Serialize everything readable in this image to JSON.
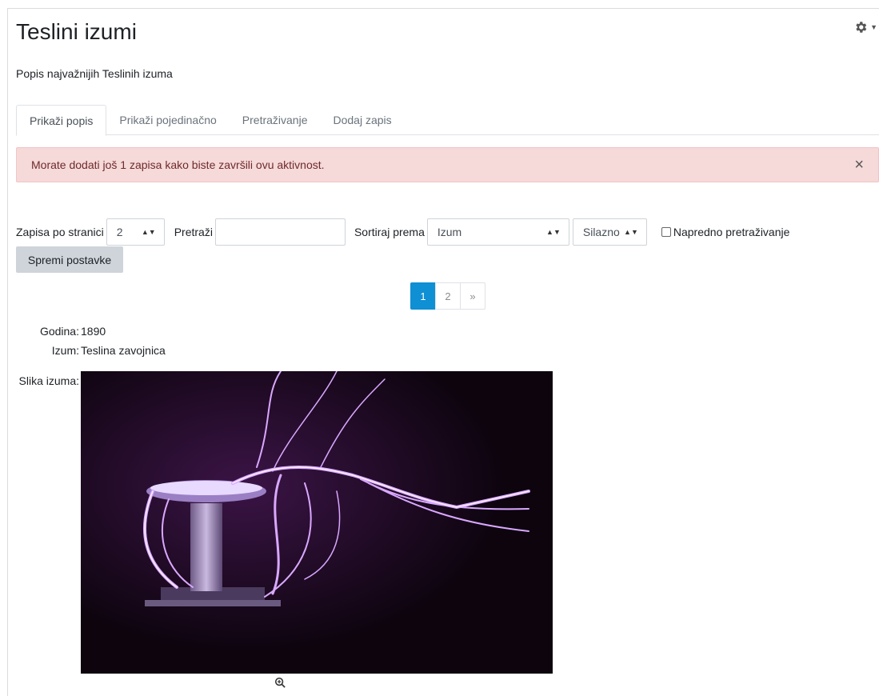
{
  "page": {
    "title": "Teslini izumi",
    "description": "Popis najvažnijih Teslinih izuma"
  },
  "tabs": [
    {
      "label": "Prikaži popis",
      "active": true
    },
    {
      "label": "Prikaži pojedinačno",
      "active": false
    },
    {
      "label": "Pretraživanje",
      "active": false
    },
    {
      "label": "Dodaj zapis",
      "active": false
    }
  ],
  "alert": {
    "message": "Morate dodati još 1 zapisa kako biste završili ovu aktivnost.",
    "close_glyph": "×"
  },
  "settings": {
    "per_page_label": "Zapisa po stranici",
    "per_page_value": "2",
    "search_label": "Pretraži",
    "search_value": "",
    "sort_label": "Sortiraj prema",
    "sort_value": "Izum",
    "order_value": "Silazno",
    "advanced_label": "Napredno pretraživanje",
    "advanced_checked": false,
    "save_label": "Spremi postavke"
  },
  "pagination": {
    "pages": [
      "1",
      "2"
    ],
    "current": "1",
    "next": "»"
  },
  "record": {
    "year_label": "Godina:",
    "year_value": "1890",
    "invention_label": "Izum:",
    "invention_value": "Teslina zavojnica",
    "image_label": "Slika izuma:"
  },
  "icons": {
    "settings": "gear-icon",
    "zoom": "zoom-in-icon"
  },
  "colors": {
    "alert_bg": "#f6d9d9",
    "pager_active": "#0f8fd4",
    "button_bg": "#ced4da"
  }
}
